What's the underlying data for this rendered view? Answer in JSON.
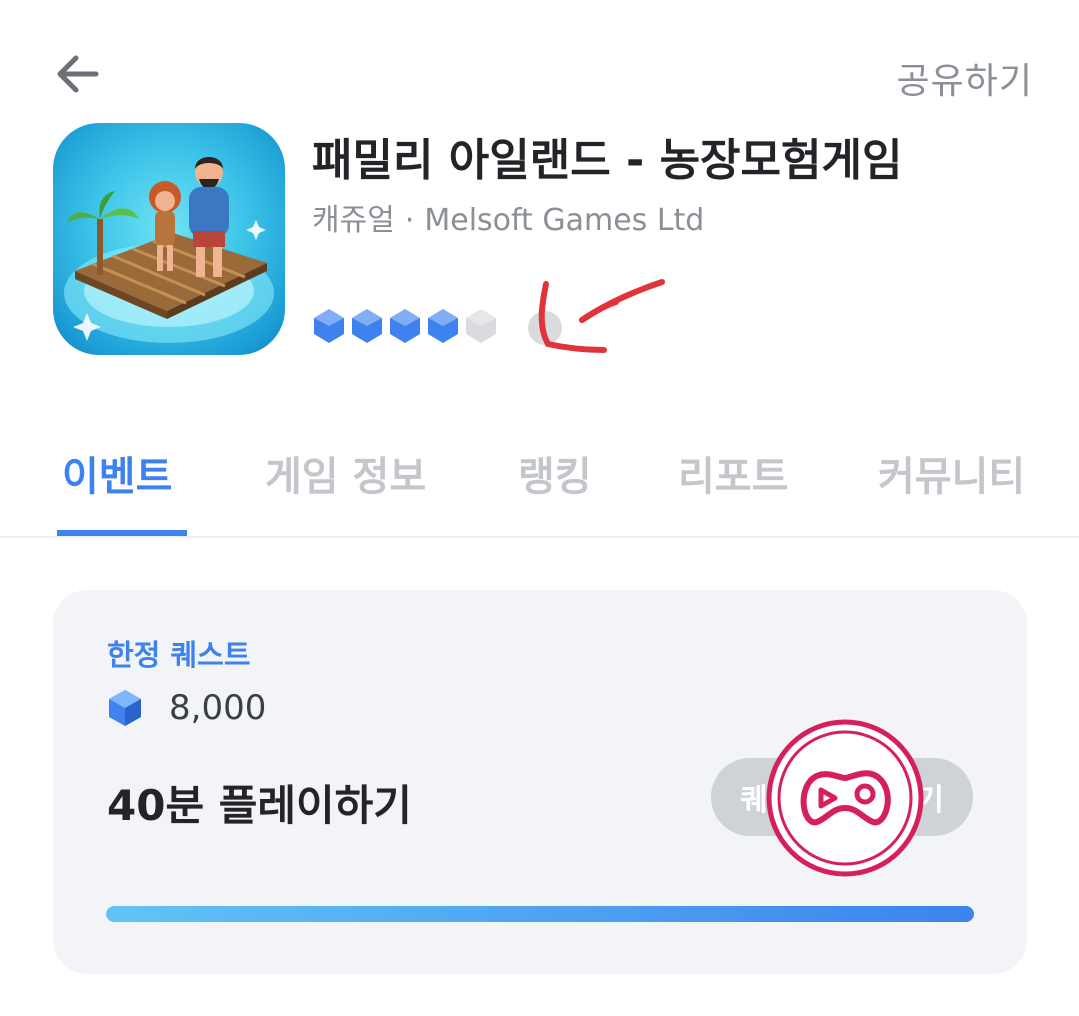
{
  "header": {
    "back_icon": "arrow-left-icon",
    "share_label": "공유하기"
  },
  "app": {
    "title": "패밀리 아일랜드 - 농장모험게임",
    "genre": "캐쥬얼",
    "separator": "·",
    "developer": "Melsoft Games Ltd",
    "icon": "family-island-app-icon",
    "rating": {
      "filled": 4,
      "total": 5,
      "filled_color": "#3d82ee",
      "empty_color": "#d9dbde"
    }
  },
  "tabs": [
    {
      "label": "이벤트",
      "active": true
    },
    {
      "label": "게임 정보",
      "active": false
    },
    {
      "label": "랭킹",
      "active": false
    },
    {
      "label": "리포트",
      "active": false
    },
    {
      "label": "커뮤니티",
      "active": false
    }
  ],
  "quest": {
    "tag": "한정 퀘스트",
    "reward_icon": "blue-gem-icon",
    "reward_amount": "8,000",
    "title": "40분 플레이하기",
    "button_label": "퀘스트 시작하기",
    "badge_icon": "gamepad-icon",
    "progress": 1.0
  },
  "colors": {
    "accent": "#3d82ee",
    "annotation": "#e0343a",
    "badge": "#d6205e"
  }
}
